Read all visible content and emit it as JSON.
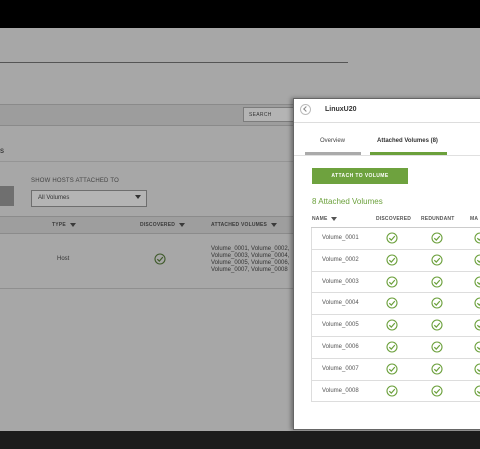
{
  "background": {
    "search_label": "SEARCH",
    "section_fragment": "S",
    "show_hosts_label": "SHOW HOSTS ATTACHED TO",
    "hosts_filter_value": "All Volumes",
    "columns": {
      "type": "TYPE",
      "discovered": "DISCOVERED",
      "attached_volumes": "ATTACHED VOLUMES"
    },
    "row": {
      "type": "Host",
      "volumes_line1": "Volume_0001, Volume_0002,",
      "volumes_line2": "Volume_0003, Volume_0004,",
      "volumes_line3": "Volume_0005, Volume_0006,",
      "volumes_line4": "Volume_0007, Volume_0008"
    }
  },
  "panel": {
    "title": "LinuxU20",
    "tabs": [
      {
        "label": "Overview"
      },
      {
        "label": "Attached Volumes (8)"
      }
    ],
    "attach_button_label": "ATTACH TO VOLUME",
    "attached_title": "8 Attached Volumes",
    "columns": {
      "name": "NAME",
      "discovered": "DISCOVERED",
      "redundant": "REDUNDANT",
      "third": "MA"
    },
    "volumes": [
      {
        "name": "Volume_0001"
      },
      {
        "name": "Volume_0002"
      },
      {
        "name": "Volume_0003"
      },
      {
        "name": "Volume_0004"
      },
      {
        "name": "Volume_0005"
      },
      {
        "name": "Volume_0006"
      },
      {
        "name": "Volume_0007"
      },
      {
        "name": "Volume_0008"
      }
    ]
  },
  "colors": {
    "accent_green": "#6ba03b",
    "overlay_gray": "#a7a7a7"
  },
  "icons": {
    "status_check": "check-circle-icon"
  }
}
